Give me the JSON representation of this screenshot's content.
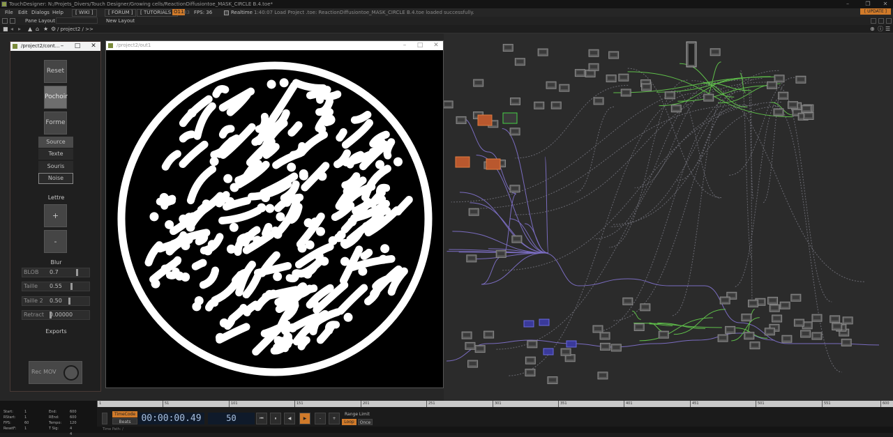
{
  "app": {
    "title": "TouchDesigner: N:/Projets_Divers/Touch Designer/Growing cells/ReactionDiffusiontoe_MASK_CIRCLE B.4.toe*"
  },
  "menu": {
    "items": [
      "File",
      "Edit",
      "Dialogs",
      "Help"
    ],
    "wiki": "[ WIKI ]",
    "forum": "[ FORUM ]",
    "tutorials": "[ TUTORIALS ]",
    "perf": "O11",
    "perf_label": "83",
    "fps": "FPS: 36",
    "realtime": "Realtime",
    "status": "1:40:07 Load Project .toe: ReactionDiffusiontoe_MASK_CIRCLE B.4.toe loaded successfully.",
    "update": "[ UPDATE ]"
  },
  "panebar": {
    "pane_layout": "Pane Layout",
    "new_layout": "New Layout"
  },
  "pathbar": {
    "path": "/ project2 / >>"
  },
  "control_panel": {
    "title": "/project2/cont...",
    "buttons": [
      {
        "label": "Reset",
        "pressed": false
      },
      {
        "label": "Pochoir",
        "pressed": true
      },
      {
        "label": "Forme",
        "pressed": false
      }
    ],
    "radios": [
      {
        "label": "Source",
        "selected": true
      },
      {
        "label": "Texte",
        "selected": false
      },
      {
        "label": "Souris",
        "selected": false
      },
      {
        "label": "Noise",
        "selected": false
      }
    ],
    "lettre_label": "Lettre",
    "plus": "+",
    "minus": "-",
    "blur_label": "Blur",
    "sliders": [
      {
        "label": "BLOB",
        "value": "0.7",
        "fraction": 0.7
      },
      {
        "label": "Taille",
        "value": "0.55",
        "fraction": 0.55
      },
      {
        "label": "Taille 2",
        "value": "0.50",
        "fraction": 0.5
      },
      {
        "label": "Retract",
        "value": "0.00000",
        "fraction": 0.0
      }
    ],
    "exports_label": "Exports",
    "rec_label": "Rec MOV"
  },
  "output_window": {
    "title": "/project2/out1"
  },
  "timeline": {
    "ticks": [
      "1",
      "51",
      "101",
      "151",
      "201",
      "251",
      "301",
      "351",
      "401",
      "451",
      "501",
      "551",
      "600"
    ],
    "info": [
      {
        "k": "Start:",
        "v": "1"
      },
      {
        "k": "RStart:",
        "v": "1"
      },
      {
        "k": "FPS:",
        "v": "60"
      },
      {
        "k": "ResetF:",
        "v": "1"
      }
    ],
    "info2": [
      {
        "k": "End:",
        "v": "600"
      },
      {
        "k": "REnd:",
        "v": "600"
      },
      {
        "k": "Tempo:",
        "v": "120"
      },
      {
        "k": "T Sig:",
        "v": "4    4"
      }
    ],
    "timecode_btn": "TimeCode",
    "beats_btn": "Beats",
    "timecode": "00:00:00.49",
    "frame": "50",
    "range_limit": "Range Limit",
    "loop": "Loop",
    "once": "Once",
    "time_path": "Time Path: /",
    "transport": [
      "⏮",
      "⏸",
      "◀",
      "▶",
      "-",
      "+"
    ]
  }
}
